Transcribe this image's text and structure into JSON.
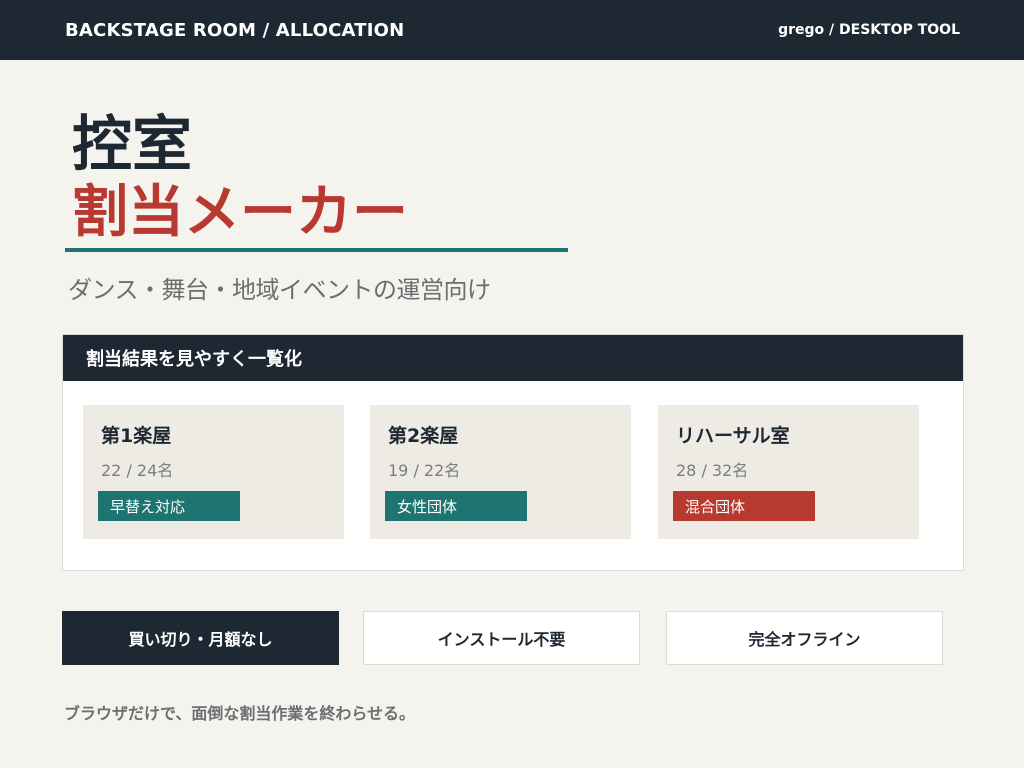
{
  "header": {
    "title": "BACKSTAGE ROOM / ALLOCATION",
    "tool_label": "grego / DESKTOP TOOL"
  },
  "hero": {
    "title_line1": "控室",
    "title_line2": "割当メーカー",
    "subtitle": "ダンス・舞台・地域イベントの運営向け"
  },
  "panel": {
    "heading": "割当結果を見やすく一覧化",
    "rooms": [
      {
        "name": "第1楽屋",
        "count": "22 / 24名",
        "tag": "早替え対応",
        "tag_color": "#1e7470"
      },
      {
        "name": "第2楽屋",
        "count": "19 / 22名",
        "tag": "女性団体",
        "tag_color": "#1e7470"
      },
      {
        "name": "リハーサル室",
        "count": "28 / 32名",
        "tag": "混合団体",
        "tag_color": "#b8392f"
      }
    ]
  },
  "features": [
    {
      "label": "買い切り・月額なし"
    },
    {
      "label": "インストール不要"
    },
    {
      "label": "完全オフライン"
    }
  ],
  "tagline": "ブラウザだけで、面倒な割当作業を終わらせる。",
  "colors": {
    "navy": "#1e2833",
    "accent_red": "#b8392f",
    "accent_teal": "#1e7470",
    "background": "#f5f3ee"
  }
}
